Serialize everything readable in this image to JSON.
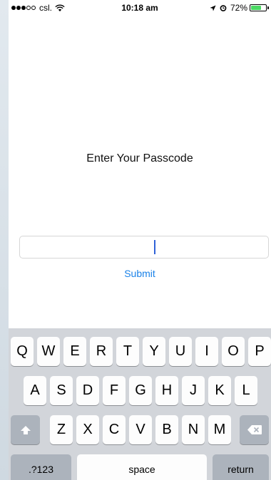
{
  "status_bar": {
    "carrier": "csl.",
    "time": "10:18 am",
    "battery": "72%",
    "battery_level": 0.72,
    "icons": [
      "signal-dots",
      "wifi-icon",
      "location-arrow-icon",
      "alarm-icon",
      "battery-icon"
    ]
  },
  "prompt": "Enter Your Passcode",
  "passcode_value": "",
  "submit_label": "Submit",
  "colors": {
    "accent": "#1a82e8",
    "cursor": "#2f62d7",
    "battery_fill": "#4cd964",
    "keyboard_bg": "#d2d5da"
  },
  "keyboard": {
    "row1": [
      "Q",
      "W",
      "E",
      "R",
      "T",
      "Y",
      "U",
      "I",
      "O",
      "P"
    ],
    "row2": [
      "A",
      "S",
      "D",
      "F",
      "G",
      "H",
      "J",
      "K",
      "L"
    ],
    "row3": [
      "Z",
      "X",
      "C",
      "V",
      "B",
      "N",
      "M"
    ],
    "numbers_label": ".?123",
    "space_label": "space",
    "return_label": "return",
    "shift_icon": "shift-arrow-icon",
    "delete_icon": "backspace-icon"
  }
}
